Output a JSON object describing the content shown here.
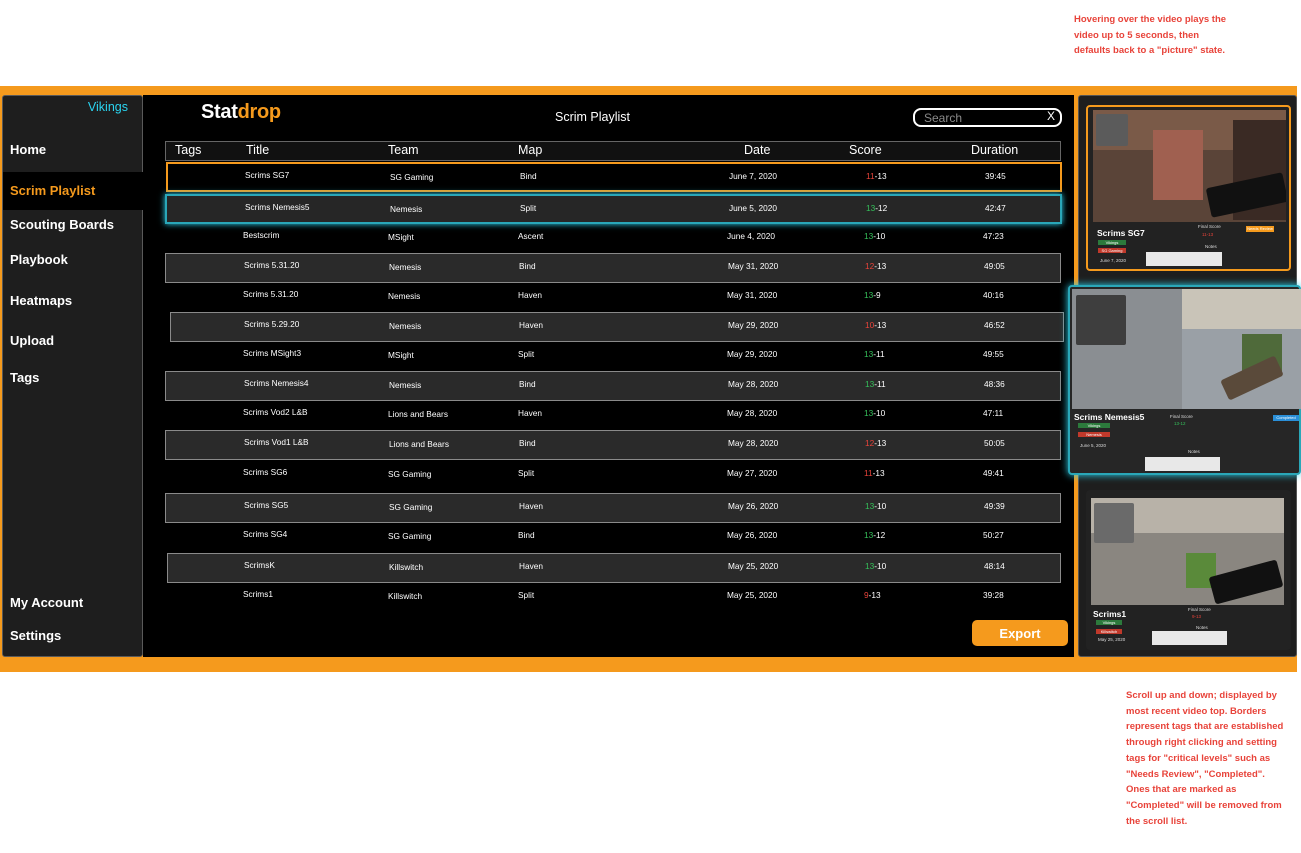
{
  "notes": {
    "top": "Hovering over the video plays the video up to 5 seconds, then defaults back to a \"picture\" state.",
    "bottom": "Scroll up and down; displayed by most recent video top. Borders represent tags that are established through right clicking and setting tags for \"critical levels\" such as \"Needs Review\", \"Completed\". Ones that are marked as \"Completed\" will be removed from the scroll list."
  },
  "colors": {
    "accent": "#f59a1d",
    "cyan": "#2ad4f0",
    "win": "#35c05a",
    "loss": "#e8433a"
  },
  "sidebar": {
    "user": "Vikings",
    "items": [
      {
        "label": "Home"
      },
      {
        "label": "Scrim Playlist",
        "active": true
      },
      {
        "label": "Scouting Boards"
      },
      {
        "label": "Playbook"
      },
      {
        "label": "Heatmaps"
      },
      {
        "label": "Upload"
      },
      {
        "label": "Tags"
      }
    ],
    "bottom": [
      {
        "label": "My Account"
      },
      {
        "label": "Settings"
      }
    ]
  },
  "header": {
    "logo_a": "Stat",
    "logo_b": "drop",
    "title": "Scrim Playlist"
  },
  "search": {
    "placeholder": "Search",
    "clear": "X"
  },
  "table": {
    "columns": [
      "Tags",
      "Title",
      "Team",
      "Map",
      "Date",
      "Score",
      "Duration"
    ],
    "rows": [
      {
        "title": "Scrims SG7",
        "team": "SG Gaming",
        "map": "Bind",
        "date": "June 7, 2020",
        "s1": "11",
        "s2": "13",
        "result": "loss",
        "duration": "39:45",
        "tag": "review"
      },
      {
        "title": "Scrims Nemesis5",
        "team": "Nemesis",
        "map": "Split",
        "date": "June 5, 2020",
        "s1": "13",
        "s2": "12",
        "result": "win",
        "duration": "42:47",
        "tag": "complete"
      },
      {
        "title": "Bestscrim",
        "team": "MSight",
        "map": "Ascent",
        "date": "June 4, 2020",
        "s1": "13",
        "s2": "10",
        "result": "win",
        "duration": "47:23"
      },
      {
        "title": "Scrims 5.31.20",
        "team": "Nemesis",
        "map": "Bind",
        "date": "May 31, 2020",
        "s1": "12",
        "s2": "13",
        "result": "loss",
        "duration": "49:05"
      },
      {
        "title": "Scrims 5.31.20",
        "team": "Nemesis",
        "map": "Haven",
        "date": "May 31, 2020",
        "s1": "13",
        "s2": "9",
        "result": "win",
        "duration": "40:16"
      },
      {
        "title": "Scrims 5.29.20",
        "team": "Nemesis",
        "map": "Haven",
        "date": "May 29, 2020",
        "s1": "10",
        "s2": "13",
        "result": "loss",
        "duration": "46:52"
      },
      {
        "title": "Scrims MSight3",
        "team": "MSight",
        "map": "Split",
        "date": "May 29, 2020",
        "s1": "13",
        "s2": "11",
        "result": "win",
        "duration": "49:55"
      },
      {
        "title": "Scrims Nemesis4",
        "team": "Nemesis",
        "map": "Bind",
        "date": "May 28, 2020",
        "s1": "13",
        "s2": "11",
        "result": "win",
        "duration": "48:36"
      },
      {
        "title": "Scrims Vod2 L&B",
        "team": "Lions and Bears",
        "map": "Haven",
        "date": "May 28, 2020",
        "s1": "13",
        "s2": "10",
        "result": "win",
        "duration": "47:11"
      },
      {
        "title": "Scrims Vod1 L&B",
        "team": "Lions and Bears",
        "map": "Bind",
        "date": "May 28, 2020",
        "s1": "12",
        "s2": "13",
        "result": "loss",
        "duration": "50:05"
      },
      {
        "title": "Scrims SG6",
        "team": "SG Gaming",
        "map": "Split",
        "date": "May 27, 2020",
        "s1": "11",
        "s2": "13",
        "result": "loss",
        "duration": "49:41"
      },
      {
        "title": "Scrims SG5",
        "team": "SG Gaming",
        "map": "Haven",
        "date": "May 26, 2020",
        "s1": "13",
        "s2": "10",
        "result": "win",
        "duration": "49:39"
      },
      {
        "title": "Scrims SG4",
        "team": "SG Gaming",
        "map": "Bind",
        "date": "May 26, 2020",
        "s1": "13",
        "s2": "12",
        "result": "win",
        "duration": "50:27"
      },
      {
        "title": "ScrimsK",
        "team": "Killswitch",
        "map": "Haven",
        "date": "May 25, 2020",
        "s1": "13",
        "s2": "10",
        "result": "win",
        "duration": "48:14"
      },
      {
        "title": "Scrims1",
        "team": "Killswitch",
        "map": "Split",
        "date": "May 25, 2020",
        "s1": "9",
        "s2": "13",
        "result": "loss",
        "duration": "39:28"
      }
    ]
  },
  "export_label": "Export",
  "previews": [
    {
      "title": "Scrims SG7",
      "team_a": "Vikings",
      "team_b": "SG Gaming",
      "date": "June 7, 2020",
      "final_label": "Final Score",
      "score": "11-13",
      "status": "Needs Review",
      "notes_label": "Notes"
    },
    {
      "title": "Scrims Nemesis5",
      "team_a": "Vikings",
      "team_b": "Nemesis",
      "date": "June 5, 2020",
      "final_label": "Final Score",
      "score": "13-12",
      "status": "Completed",
      "notes_label": "Notes"
    },
    {
      "title": "Scrims1",
      "team_a": "Vikings",
      "team_b": "Killswitch",
      "date": "May 25, 2020",
      "final_label": "Final Score",
      "score": "9-13",
      "status": "",
      "notes_label": "Notes"
    }
  ]
}
